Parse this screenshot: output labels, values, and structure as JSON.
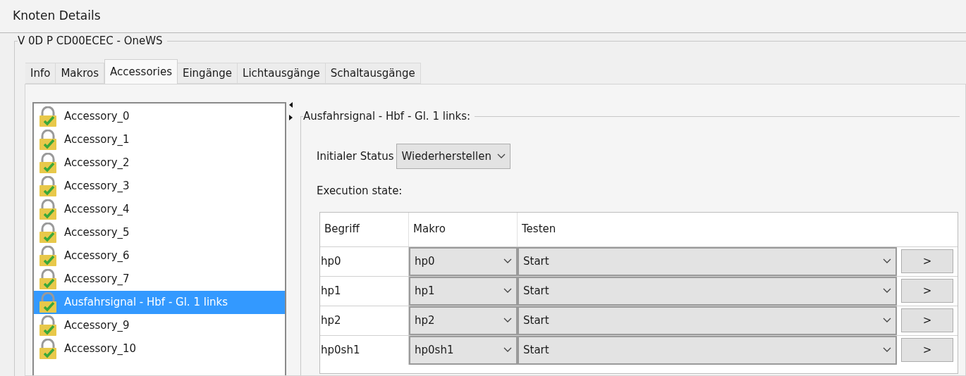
{
  "window": {
    "title": "Knoten Details"
  },
  "node_group": {
    "title": "V 0D P CD00ECEC - OneWS"
  },
  "tabs": [
    {
      "label": "Info",
      "selected": false
    },
    {
      "label": "Makros",
      "selected": false
    },
    {
      "label": "Accessories",
      "selected": true
    },
    {
      "label": "Eingänge",
      "selected": false
    },
    {
      "label": "Lichtausgänge",
      "selected": false
    },
    {
      "label": "Schaltausgänge",
      "selected": false
    }
  ],
  "accessory_list": [
    {
      "label": "Accessory_0",
      "selected": false
    },
    {
      "label": "Accessory_1",
      "selected": false
    },
    {
      "label": "Accessory_2",
      "selected": false
    },
    {
      "label": "Accessory_3",
      "selected": false
    },
    {
      "label": "Accessory_4",
      "selected": false
    },
    {
      "label": "Accessory_5",
      "selected": false
    },
    {
      "label": "Accessory_6",
      "selected": false
    },
    {
      "label": "Accessory_7",
      "selected": false
    },
    {
      "label": "Ausfahrsignal - Hbf - Gl. 1 links",
      "selected": true
    },
    {
      "label": "Accessory_9",
      "selected": false
    },
    {
      "label": "Accessory_10",
      "selected": false
    }
  ],
  "detail": {
    "title": "Ausfahrsignal - Hbf - Gl. 1 links:",
    "initial_status": {
      "label": "Initialer Status",
      "value": "Wiederherstellen"
    },
    "execution_label": "Execution state:",
    "table": {
      "columns": [
        "Begriff",
        "Makro",
        "Testen"
      ],
      "rows": [
        {
          "begriff": "hp0",
          "makro": "hp0",
          "testen": "Start",
          "button": ">"
        },
        {
          "begriff": "hp1",
          "makro": "hp1",
          "testen": "Start",
          "button": ">"
        },
        {
          "begriff": "hp2",
          "makro": "hp2",
          "testen": "Start",
          "button": ">"
        },
        {
          "begriff": "hp0sh1",
          "makro": "hp0sh1",
          "testen": "Start",
          "button": ">"
        }
      ]
    }
  }
}
